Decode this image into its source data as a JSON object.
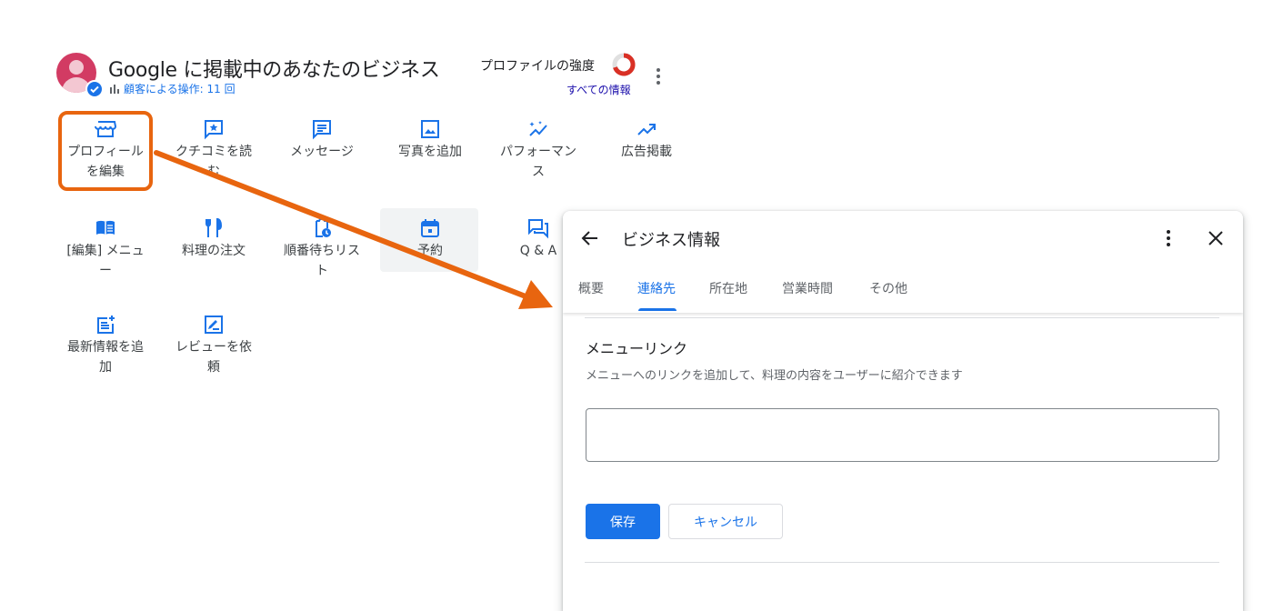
{
  "header": {
    "business_name": "Google に掲載中のあなたのビジネス",
    "customer_actions": "顧客による操作: 11 回",
    "strength_label": "プロファイルの強度",
    "all_info_link": "すべての情報",
    "strength_icon": "ring-progress",
    "accent": "#1a73e8"
  },
  "actions": {
    "row1": [
      {
        "label": "プロフィールを編集",
        "icon": "storefront-icon"
      },
      {
        "label": "クチコミを読む",
        "icon": "review-star-icon"
      },
      {
        "label": "メッセージ",
        "icon": "message-icon"
      },
      {
        "label": "写真を追加",
        "icon": "photo-icon"
      },
      {
        "label": "パフォーマンス",
        "icon": "sparkle-chart-icon"
      },
      {
        "label": "広告掲載",
        "icon": "trending-up-icon"
      }
    ],
    "row2": [
      {
        "label": "[編集] メニュー",
        "icon": "menu-book-icon"
      },
      {
        "label": "料理の注文",
        "icon": "restaurant-icon"
      },
      {
        "label": "順番待ちリスト",
        "icon": "pending-clipboard-icon"
      },
      {
        "label": "予約",
        "icon": "event-icon"
      },
      {
        "label": "Q & A",
        "icon": "forum-icon"
      }
    ],
    "row3": [
      {
        "label": "最新情報を追加",
        "icon": "post-add-icon"
      },
      {
        "label": "レビューを依頼",
        "icon": "rate-review-icon"
      }
    ]
  },
  "panel": {
    "title": "ビジネス情報",
    "tabs": [
      {
        "label": "概要",
        "active": false
      },
      {
        "label": "連絡先",
        "active": true
      },
      {
        "label": "所在地",
        "active": false
      },
      {
        "label": "営業時間",
        "active": false
      },
      {
        "label": "その他",
        "active": false
      }
    ],
    "section_title": "メニューリンク",
    "section_desc": "メニューへのリンクを追加して、料理の内容をユーザーに紹介できます",
    "input_value": "",
    "save_label": "保存",
    "cancel_label": "キャンセル"
  },
  "annotation": {
    "highlight_color": "#e8650f"
  }
}
